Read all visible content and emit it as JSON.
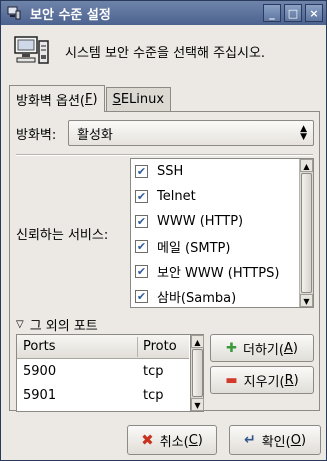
{
  "window": {
    "title": "보안 수준 설정",
    "controls": [
      "_",
      "□",
      "×"
    ]
  },
  "header": {
    "prompt": "시스템 보안 수준을 선택해 주십시오."
  },
  "tabs": [
    {
      "label": "방화벽 옵션(",
      "mnemonic": "F",
      "suffix": ")",
      "active": true
    },
    {
      "label": "",
      "mnemonic": "S",
      "suffix": "ELinux",
      "active": false
    }
  ],
  "firewall": {
    "label": "방화벽:",
    "value": "활성화"
  },
  "services": {
    "label": "신뢰하는 서비스:",
    "items": [
      {
        "label": "SSH",
        "checked": true
      },
      {
        "label": "Telnet",
        "checked": true
      },
      {
        "label": "WWW (HTTP)",
        "checked": true
      },
      {
        "label": "메일 (SMTP)",
        "checked": true
      },
      {
        "label": "보안 WWW (HTTPS)",
        "checked": true
      },
      {
        "label": "삼바(Samba)",
        "checked": true
      }
    ]
  },
  "other_ports": {
    "label": "그 외의 포트",
    "columns": [
      "Ports",
      "Proto"
    ],
    "rows": [
      {
        "port": "5900",
        "proto": "tcp"
      },
      {
        "port": "5901",
        "proto": "tcp"
      }
    ],
    "add_button": {
      "label": "더하기(",
      "mnemonic": "A",
      "suffix": ")"
    },
    "remove_button": {
      "label": "지우기(",
      "mnemonic": "R",
      "suffix": ")"
    }
  },
  "dialog_buttons": {
    "cancel": {
      "label": "취소(",
      "mnemonic": "C",
      "suffix": ")"
    },
    "ok": {
      "label": "확인(",
      "mnemonic": "O",
      "suffix": ")"
    }
  },
  "colors": {
    "titlebar": "#5a709a",
    "window_bg": "#ece9e4",
    "check": "#2e5c9a",
    "add_icon": "#3a9a3a",
    "remove_icon": "#d23a2a",
    "cancel_icon": "#c8321e"
  }
}
